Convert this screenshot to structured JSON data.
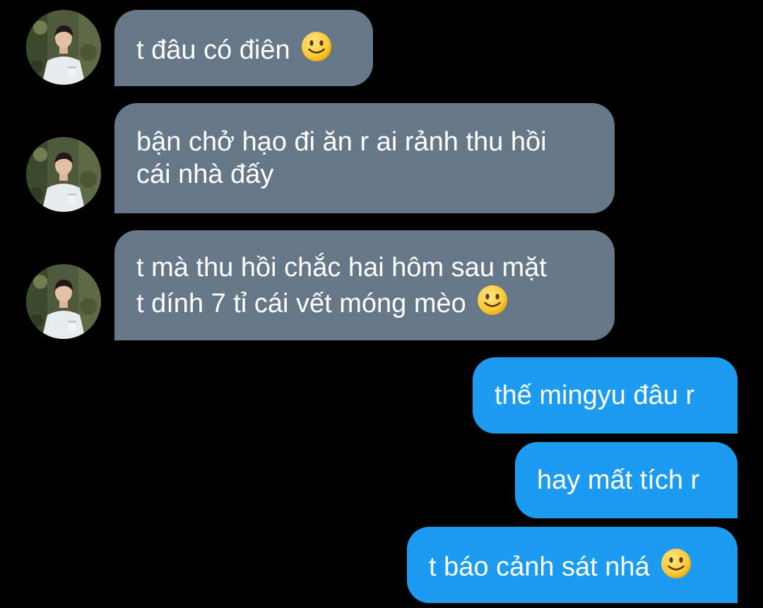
{
  "conversation": {
    "incoming": [
      {
        "lines": [
          "t đâu có điên"
        ],
        "emoji": "slightly-smiling-face"
      },
      {
        "lines": [
          "bận chở hạo đi ăn r ai rảnh thu hồi",
          "cái nhà đấy"
        ],
        "emoji": null
      },
      {
        "lines": [
          "t mà thu hồi chắc hai hôm sau mặt",
          "t dính 7 tỉ cái vết móng mèo"
        ],
        "emoji": "slightly-smiling-face"
      }
    ],
    "outgoing": [
      {
        "lines": [
          "thế mingyu đâu r"
        ],
        "emoji": null
      },
      {
        "lines": [
          "hay mất tích r"
        ],
        "emoji": null
      },
      {
        "lines": [
          "t báo cảnh sát nhá"
        ],
        "emoji": "slightly-smiling-face"
      }
    ]
  },
  "colors": {
    "background": "#000000",
    "incoming_bubble": "#667788",
    "outgoing_bubble": "#1d9bf0",
    "text": "#ffffff"
  }
}
